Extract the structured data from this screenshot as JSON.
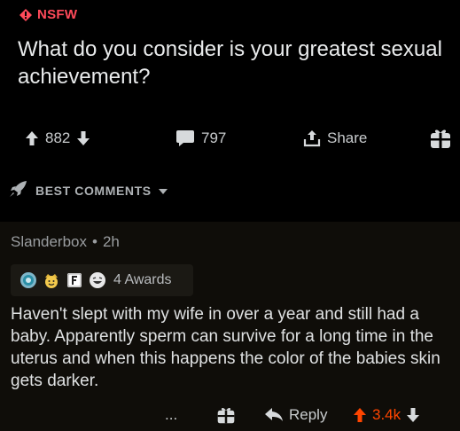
{
  "post": {
    "nsfw_label": "NSFW",
    "title": "What do you consider is your greatest sexual achievement?",
    "upvotes": "882",
    "comments": "797",
    "share_label": "Share"
  },
  "sort": {
    "label": "BEST COMMENTS"
  },
  "comment": {
    "author": "Slanderbox",
    "separator": "•",
    "age": "2h",
    "awards_label": "4 Awards",
    "body": "Haven't slept with my wife in over a year and still had a baby. Apparently sperm can survive for a long time in the uterus and when this happens the color of the babies skin gets darker.",
    "more_label": "...",
    "reply_label": "Reply",
    "score": "3.4k"
  },
  "colors": {
    "nsfw": "#ff4a5a",
    "upvote_active": "#ff4500",
    "background": "#000000",
    "comment_background": "#0f0d09"
  }
}
